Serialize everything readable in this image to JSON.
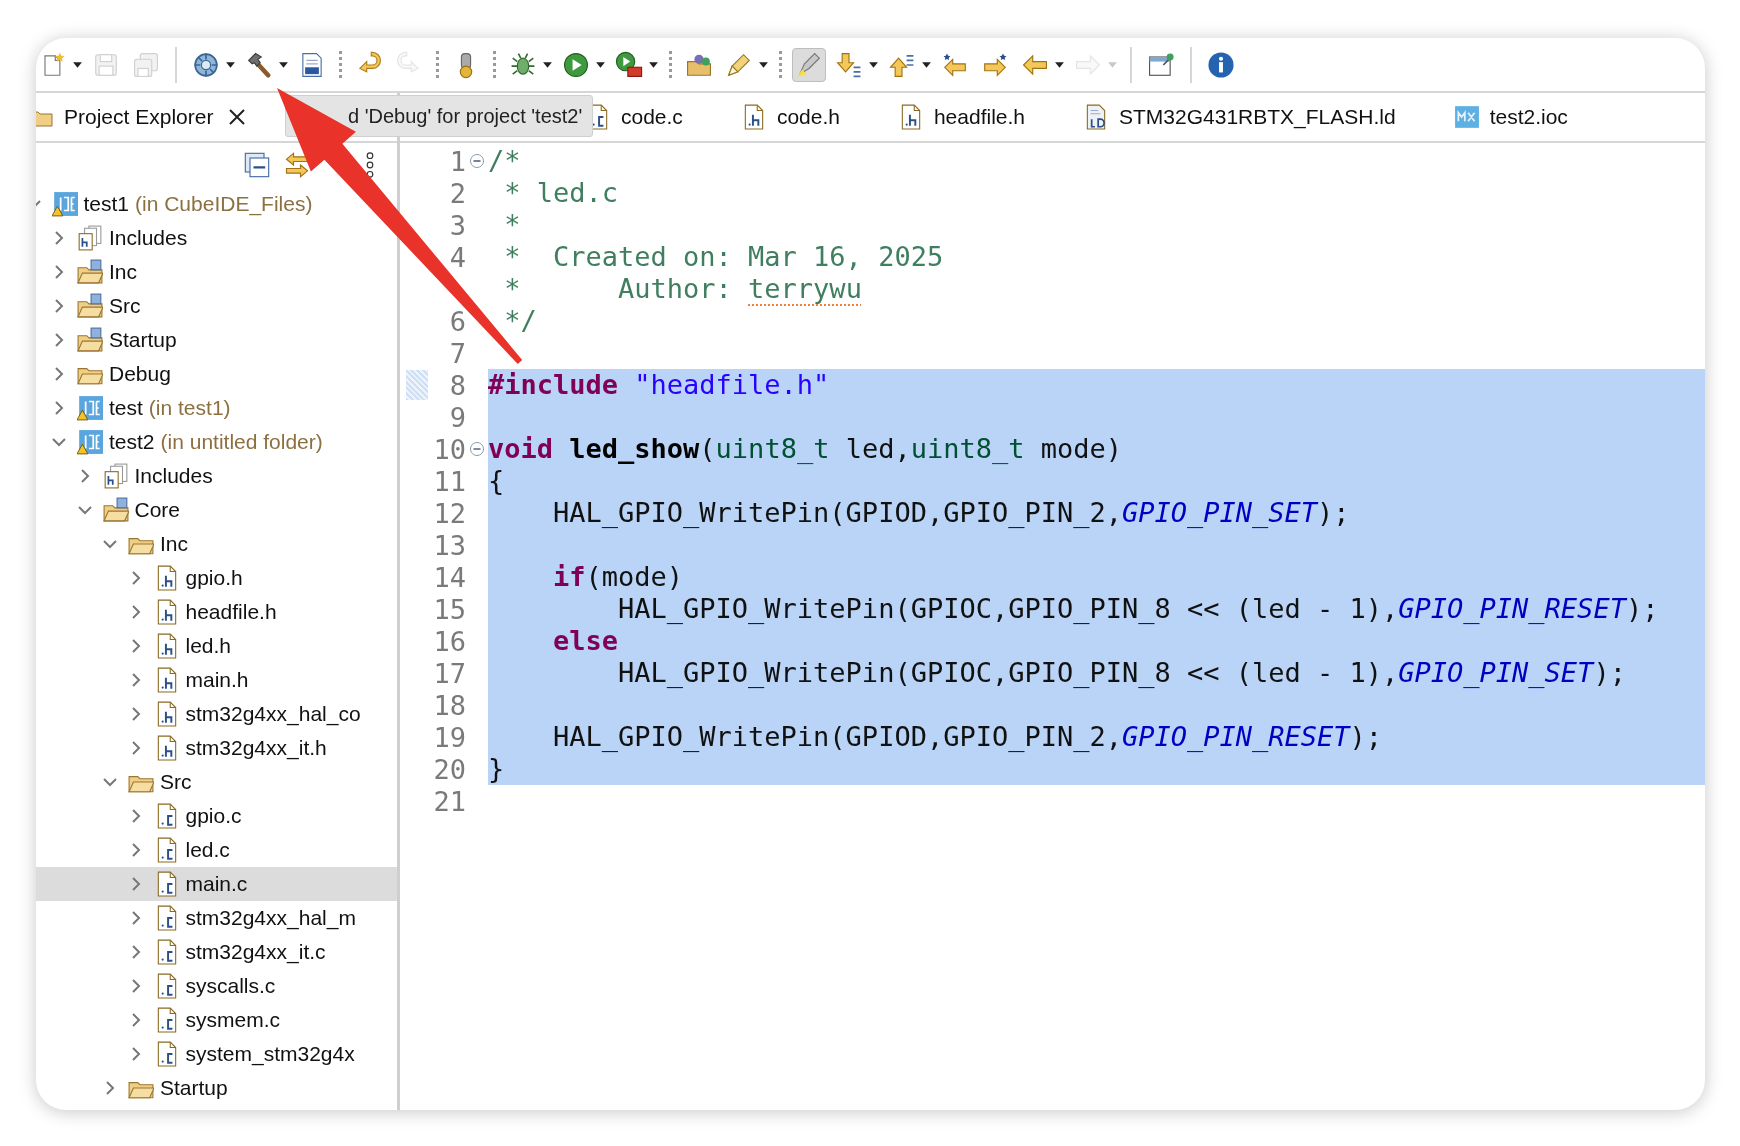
{
  "toolbar": [
    {
      "kind": "new",
      "dropdown": true,
      "disabled": false,
      "pressed": false
    },
    {
      "kind": "save",
      "dropdown": false,
      "disabled": true,
      "pressed": false
    },
    {
      "kind": "save-all",
      "dropdown": false,
      "disabled": true,
      "pressed": false
    },
    {
      "kind": "separator"
    },
    {
      "kind": "gear",
      "dropdown": true,
      "disabled": false,
      "pressed": false
    },
    {
      "kind": "hammer",
      "dropdown": true,
      "disabled": false,
      "pressed": false
    },
    {
      "kind": "binary",
      "dropdown": false,
      "disabled": false,
      "pressed": false
    },
    {
      "kind": "dots"
    },
    {
      "kind": "undo",
      "dropdown": false,
      "disabled": false,
      "pressed": false
    },
    {
      "kind": "redo",
      "dropdown": false,
      "disabled": true,
      "pressed": false
    },
    {
      "kind": "dots"
    },
    {
      "kind": "device",
      "dropdown": false,
      "disabled": false,
      "pressed": false
    },
    {
      "kind": "dots"
    },
    {
      "kind": "bug",
      "dropdown": true,
      "disabled": false,
      "pressed": false
    },
    {
      "kind": "run",
      "dropdown": true,
      "disabled": false,
      "pressed": false
    },
    {
      "kind": "run-ext",
      "dropdown": true,
      "disabled": false,
      "pressed": false
    },
    {
      "kind": "dots"
    },
    {
      "kind": "open-folder",
      "dropdown": false,
      "disabled": false,
      "pressed": false
    },
    {
      "kind": "pen",
      "dropdown": true,
      "disabled": false,
      "pressed": false
    },
    {
      "kind": "dots"
    },
    {
      "kind": "highlighter",
      "dropdown": false,
      "disabled": false,
      "pressed": true
    },
    {
      "kind": "next-ann",
      "dropdown": true,
      "disabled": false,
      "pressed": false
    },
    {
      "kind": "prev-ann",
      "dropdown": true,
      "disabled": false,
      "pressed": false
    },
    {
      "kind": "back-star",
      "dropdown": false,
      "disabled": false,
      "pressed": false
    },
    {
      "kind": "fwd-star",
      "dropdown": false,
      "disabled": false,
      "pressed": false
    },
    {
      "kind": "back",
      "dropdown": true,
      "disabled": false,
      "pressed": false
    },
    {
      "kind": "forward",
      "dropdown": true,
      "disabled": true,
      "pressed": false
    },
    {
      "kind": "separator"
    },
    {
      "kind": "pin",
      "dropdown": false,
      "disabled": false,
      "pressed": false
    },
    {
      "kind": "separator"
    },
    {
      "kind": "info",
      "dropdown": false,
      "disabled": false,
      "pressed": false
    }
  ],
  "explorer": {
    "title": "Project Explorer",
    "tree": [
      {
        "label": "test1",
        "note": "(in CubeIDE_Files)",
        "kind": "project",
        "expanded": true,
        "selected": false,
        "children": [
          {
            "label": "Includes",
            "kind": "includes",
            "expanded": false,
            "selected": false
          },
          {
            "label": "Inc",
            "kind": "source-folder",
            "expanded": false,
            "selected": false
          },
          {
            "label": "Src",
            "kind": "source-folder",
            "expanded": false,
            "selected": false
          },
          {
            "label": "Startup",
            "kind": "source-folder",
            "expanded": false,
            "selected": false
          },
          {
            "label": "Debug",
            "kind": "folder",
            "expanded": false,
            "selected": false
          },
          {
            "label": "test",
            "note": "(in test1)",
            "kind": "project",
            "expanded": false,
            "selected": false
          },
          {
            "label": "test2",
            "note": "(in untitled folder)",
            "kind": "project",
            "expanded": true,
            "selected": false,
            "children": [
              {
                "label": "Includes",
                "kind": "includes",
                "expanded": false,
                "selected": false
              },
              {
                "label": "Core",
                "kind": "source-folder",
                "expanded": true,
                "selected": false,
                "children": [
                  {
                    "label": "Inc",
                    "kind": "folder",
                    "expanded": true,
                    "selected": false,
                    "children": [
                      {
                        "label": "gpio.h",
                        "kind": "header",
                        "expanded": false,
                        "selected": false
                      },
                      {
                        "label": "headfile.h",
                        "kind": "header",
                        "expanded": false,
                        "selected": false
                      },
                      {
                        "label": "led.h",
                        "kind": "header",
                        "expanded": false,
                        "selected": false
                      },
                      {
                        "label": "main.h",
                        "kind": "header",
                        "expanded": false,
                        "selected": false
                      },
                      {
                        "label": "stm32g4xx_hal_co",
                        "kind": "header",
                        "expanded": false,
                        "selected": false
                      },
                      {
                        "label": "stm32g4xx_it.h",
                        "kind": "header",
                        "expanded": false,
                        "selected": false
                      }
                    ]
                  },
                  {
                    "label": "Src",
                    "kind": "folder",
                    "expanded": true,
                    "selected": false,
                    "children": [
                      {
                        "label": "gpio.c",
                        "kind": "source",
                        "expanded": false,
                        "selected": false
                      },
                      {
                        "label": "led.c",
                        "kind": "source",
                        "expanded": false,
                        "selected": false
                      },
                      {
                        "label": "main.c",
                        "kind": "source",
                        "expanded": false,
                        "selected": true
                      },
                      {
                        "label": "stm32g4xx_hal_m",
                        "kind": "source",
                        "expanded": false,
                        "selected": false
                      },
                      {
                        "label": "stm32g4xx_it.c",
                        "kind": "source",
                        "expanded": false,
                        "selected": false
                      },
                      {
                        "label": "syscalls.c",
                        "kind": "source",
                        "expanded": false,
                        "selected": false
                      },
                      {
                        "label": "sysmem.c",
                        "kind": "source",
                        "expanded": false,
                        "selected": false
                      },
                      {
                        "label": "system_stm32g4x",
                        "kind": "source",
                        "expanded": false,
                        "selected": false
                      }
                    ]
                  },
                  {
                    "label": "Startup",
                    "kind": "folder",
                    "expanded": false,
                    "selected": false
                  }
                ]
              }
            ]
          }
        ]
      }
    ]
  },
  "tooltip": {
    "text": "d 'Debug' for project 'test2'"
  },
  "editor": {
    "tabs": [
      {
        "label": "code.c",
        "kind": "source",
        "selected": false
      },
      {
        "label": "code.h",
        "kind": "header",
        "selected": false
      },
      {
        "label": "headfile.h",
        "kind": "header",
        "selected": false
      },
      {
        "label": "STM32G431RBTX_FLASH.ld",
        "kind": "linker",
        "selected": false
      },
      {
        "label": "test2.ioc",
        "kind": "ioc",
        "selected": false
      }
    ],
    "lines": [
      {
        "number": "1",
        "fold": true,
        "marked": false,
        "selected": false,
        "tokens": [
          {
            "text": "/*",
            "kind": "comment"
          }
        ]
      },
      {
        "number": "2",
        "fold": false,
        "marked": false,
        "selected": false,
        "tokens": [
          {
            "text": " * led.c",
            "kind": "comment"
          }
        ]
      },
      {
        "number": "3",
        "fold": false,
        "marked": false,
        "selected": false,
        "tokens": [
          {
            "text": " *",
            "kind": "comment"
          }
        ]
      },
      {
        "number": "4",
        "fold": false,
        "marked": false,
        "selected": false,
        "tokens": [
          {
            "text": " *  Created on: Mar 16, 2025",
            "kind": "comment"
          }
        ]
      },
      {
        "fold": false,
        "marked": false,
        "selected": false,
        "tokens": [
          {
            "text": " *      Author: ",
            "kind": "comment"
          },
          {
            "text": "terrywu",
            "kind": "misspelled"
          }
        ]
      },
      {
        "number": "6",
        "fold": false,
        "marked": false,
        "selected": false,
        "tokens": [
          {
            "text": " */",
            "kind": "comment"
          }
        ]
      },
      {
        "number": "7",
        "fold": false,
        "marked": false,
        "selected": false
      },
      {
        "number": "8",
        "fold": false,
        "marked": true,
        "selected": true,
        "tokens": [
          {
            "text": "#include",
            "kind": "keyword"
          },
          {
            "text": " \"headfile.h\"",
            "kind": "string"
          }
        ]
      },
      {
        "number": "9",
        "fold": false,
        "marked": false,
        "selected": true
      },
      {
        "number": "10",
        "fold": true,
        "marked": false,
        "selected": true,
        "tokens": [
          {
            "text": "void",
            "kind": "keyword"
          },
          {
            "text": " led_show",
            "kind": "function"
          },
          {
            "text": "(",
            "kind": "plain"
          },
          {
            "text": "uint8_t",
            "kind": "type"
          },
          {
            "text": " led,",
            "kind": "plain"
          },
          {
            "text": "uint8_t",
            "kind": "type"
          },
          {
            "text": " mode)",
            "kind": "plain"
          }
        ]
      },
      {
        "number": "11",
        "fold": false,
        "marked": false,
        "selected": true,
        "tokens": [
          {
            "text": "{",
            "kind": "plain"
          }
        ]
      },
      {
        "number": "12",
        "fold": false,
        "marked": false,
        "selected": true,
        "tokens": [
          {
            "text": "    HAL_GPIO_WritePin(GPIOD,GPIO_PIN_2,",
            "kind": "plain"
          },
          {
            "text": "GPIO_PIN_SET",
            "kind": "constant"
          },
          {
            "text": ");",
            "kind": "plain"
          }
        ]
      },
      {
        "number": "13",
        "fold": false,
        "marked": false,
        "selected": true
      },
      {
        "number": "14",
        "fold": false,
        "marked": false,
        "selected": true,
        "tokens": [
          {
            "text": "    if",
            "kind": "keyword"
          },
          {
            "text": "(mode)",
            "kind": "plain"
          }
        ]
      },
      {
        "number": "15",
        "fold": false,
        "marked": false,
        "selected": true,
        "tokens": [
          {
            "text": "        HAL_GPIO_WritePin(GPIOC,GPIO_PIN_8 << (led - 1),",
            "kind": "plain"
          },
          {
            "text": "GPIO_PIN_RESET",
            "kind": "constant"
          },
          {
            "text": ");",
            "kind": "plain"
          }
        ]
      },
      {
        "number": "16",
        "fold": false,
        "marked": false,
        "selected": true,
        "tokens": [
          {
            "text": "    else",
            "kind": "keyword"
          }
        ]
      },
      {
        "number": "17",
        "fold": false,
        "marked": false,
        "selected": true,
        "tokens": [
          {
            "text": "        HAL_GPIO_WritePin(GPIOC,GPIO_PIN_8 << (led - 1),",
            "kind": "plain"
          },
          {
            "text": "GPIO_PIN_SET",
            "kind": "constant"
          },
          {
            "text": ");",
            "kind": "plain"
          }
        ]
      },
      {
        "number": "18",
        "fold": false,
        "marked": false,
        "selected": true
      },
      {
        "number": "19",
        "fold": false,
        "marked": false,
        "selected": true,
        "tokens": [
          {
            "text": "    HAL_GPIO_WritePin(GPIOD,GPIO_PIN_2,",
            "kind": "plain"
          },
          {
            "text": "GPIO_PIN_RESET",
            "kind": "constant"
          },
          {
            "text": ");",
            "kind": "plain"
          }
        ]
      },
      {
        "number": "20",
        "fold": false,
        "marked": false,
        "selected": true,
        "tokens": [
          {
            "text": "}",
            "kind": "plain"
          }
        ]
      },
      {
        "number": "21",
        "fold": false,
        "marked": false,
        "selected": false
      }
    ]
  }
}
